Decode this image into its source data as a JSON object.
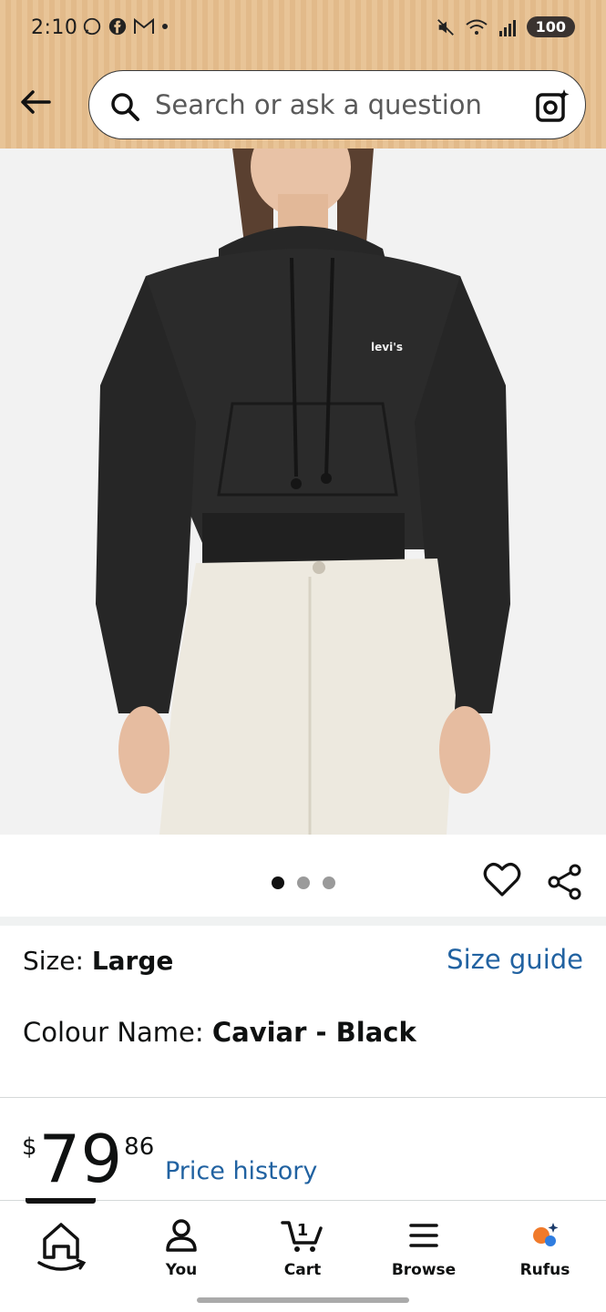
{
  "status_bar": {
    "time": "2:10",
    "battery": "100"
  },
  "search": {
    "placeholder": "Search or ask a question"
  },
  "product": {
    "hero_logo_text": "levi's",
    "carousel_count": 3,
    "carousel_active": 0,
    "size_label": "Size: ",
    "size_value": "Large",
    "size_guide": "Size guide",
    "colour_label": "Colour Name: ",
    "colour_value": "Caviar - Black",
    "price_currency": "$",
    "price_whole": "79",
    "price_fraction": "86",
    "price_history": "Price history"
  },
  "nav": {
    "items": [
      {
        "label": "",
        "icon": "home-icon"
      },
      {
        "label": "You",
        "icon": "person-icon"
      },
      {
        "label": "Cart",
        "icon": "cart-icon",
        "badge": "1"
      },
      {
        "label": "Browse",
        "icon": "menu-icon"
      },
      {
        "label": "Rufus",
        "icon": "rufus-icon"
      }
    ]
  },
  "colors": {
    "header_bg": "#e8c497",
    "link": "#2162a1",
    "text": "#0f1111"
  }
}
